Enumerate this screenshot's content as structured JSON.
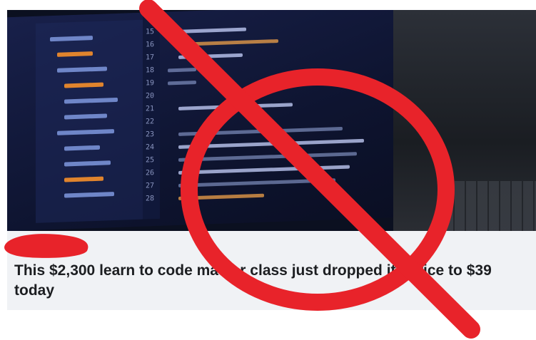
{
  "article": {
    "headline": "This $2,300 learn to code master class just dropped its price to $39 today"
  },
  "overlay": {
    "symbol": "prohibition-sign",
    "color": "#e8232a"
  },
  "hero": {
    "line_numbers": [
      "15",
      "16",
      "17",
      "18",
      "19",
      "20",
      "21",
      "22",
      "23",
      "24",
      "25",
      "26",
      "27",
      "28"
    ]
  }
}
